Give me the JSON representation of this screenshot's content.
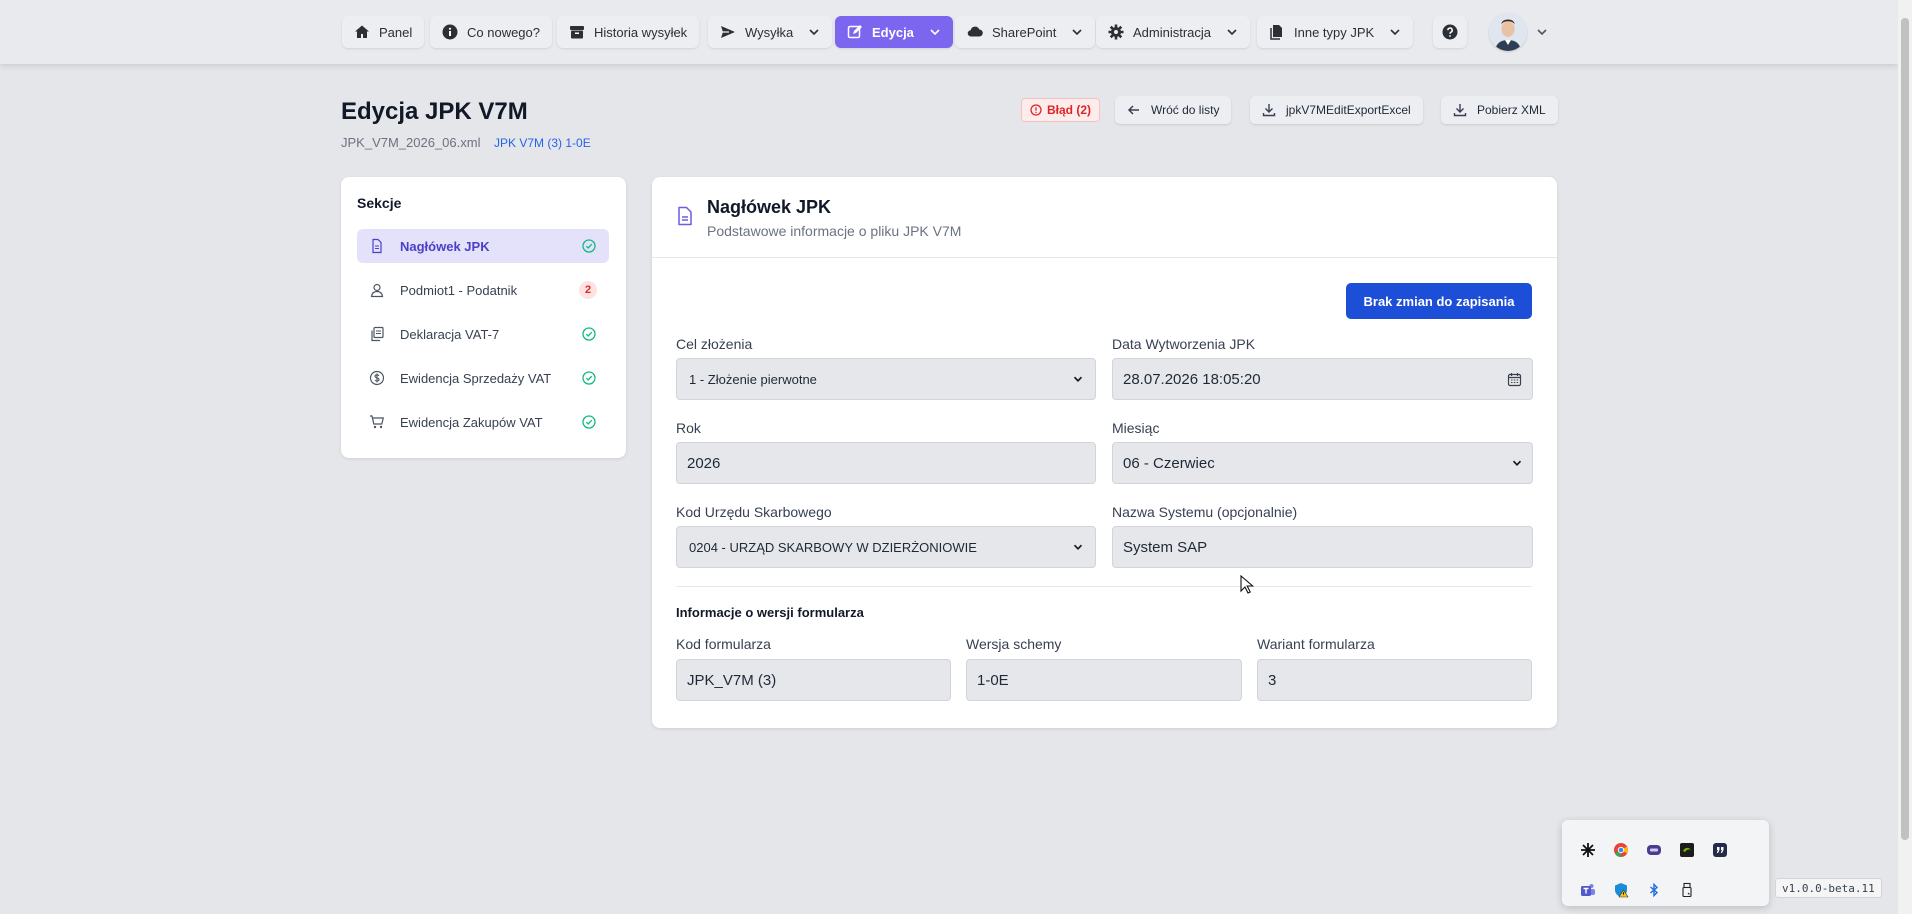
{
  "nav": {
    "items": [
      {
        "label": "Panel",
        "icon": "home-icon"
      },
      {
        "label": "Co nowego?",
        "icon": "info-icon"
      },
      {
        "label": "Historia wysyłek",
        "icon": "archive-icon"
      },
      {
        "label": "Wysyłka",
        "icon": "send-icon"
      },
      {
        "label": "Edycja",
        "icon": "edit-icon"
      },
      {
        "label": "SharePoint",
        "icon": "cloud-icon"
      },
      {
        "label": "Administracja",
        "icon": "gear-icon"
      },
      {
        "label": "Inne typy JPK",
        "icon": "files-icon"
      }
    ],
    "active": "Edycja",
    "accent_color": "#7c66f0"
  },
  "header": {
    "title": "Edycja JPK V7M",
    "file_name": "JPK_V7M_2026_06.xml",
    "version_tag": "JPK V7M (3) 1-0E",
    "error_badge": "Błąd (2)",
    "back_label": "Wróć do listy",
    "export_excel_label": "jpkV7MEditExportExcel",
    "download_xml_label": "Pobierz XML"
  },
  "sidebar": {
    "title": "Sekcje",
    "items": [
      {
        "label": "Nagłówek JPK",
        "status": "ok",
        "icon": "file-icon"
      },
      {
        "label": "Podmiot1 - Podatnik",
        "status": "errors",
        "count": "2",
        "icon": "user-icon"
      },
      {
        "label": "Deklaracja VAT-7",
        "status": "ok",
        "icon": "documents-icon"
      },
      {
        "label": "Ewidencja Sprzedaży VAT",
        "status": "ok",
        "icon": "dollar-icon"
      },
      {
        "label": "Ewidencja Zakupów VAT",
        "status": "ok",
        "icon": "cart-icon"
      }
    ]
  },
  "card": {
    "title": "Nagłówek JPK",
    "subtitle": "Podstawowe informacje o pliku JPK V7M",
    "save_button": "Brak zmian do zapisania",
    "save_color": "#1d4ed8"
  },
  "fields": {
    "cel_label": "Cel złożenia",
    "cel_value": "1 - Złożenie pierwotne",
    "data_label": "Data Wytworzenia JPK",
    "data_value": "28.07.2026 18:05:20",
    "rok_label": "Rok",
    "rok_value": "2026",
    "miesiac_label": "Miesiąc",
    "miesiac_value": "06 - Czerwiec",
    "kod_us_label": "Kod Urzędu Skarbowego",
    "kod_us_value": "0204 - URZĄD SKARBOWY W DZIERŻONIOWIE",
    "system_label": "Nazwa Systemu (opcjonalnie)",
    "system_value": "System SAP"
  },
  "form_version": {
    "title": "Informacje o wersji formularza",
    "kod_label": "Kod formularza",
    "kod_value": "JPK_V7M (3)",
    "wersja_label": "Wersja schemy",
    "wersja_value": "1-0E",
    "wariant_label": "Wariant formularza",
    "wariant_value": "3"
  },
  "app_version": "v1.0.0-beta.11",
  "error_color": "#dc2626",
  "ok_color": "#10b981"
}
